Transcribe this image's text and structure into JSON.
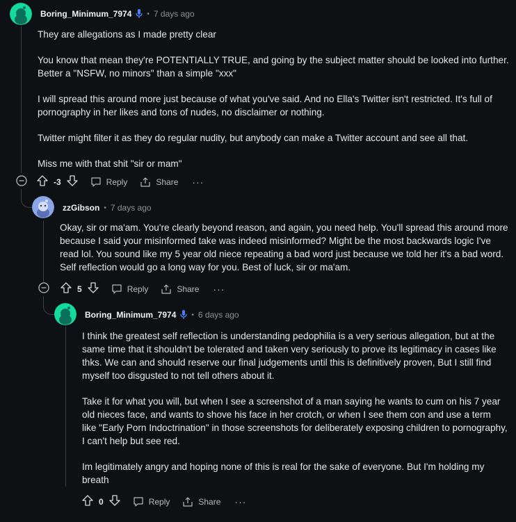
{
  "comments": [
    {
      "author": "Boring_Minimum_7974",
      "time": "7 days ago",
      "paragraphs": [
        "They are allegations as I made pretty clear",
        "You know that mean they're POTENTIALLY TRUE, and going by the subject matter should be looked into further. Better a \"NSFW, no minors\" than a simple \"xxx\"",
        "I will spread this around more just because of what you've said. And no Ella's Twitter isn't restricted. It's full of pornography in her likes and tons of nudes, no disclaimer or nothing.",
        "Twitter might filter it as they do regular nudity, but anybody can make a Twitter account and see all that.",
        "Miss me with that shit \"sir or mam\""
      ],
      "score": "-3",
      "reply_label": "Reply",
      "share_label": "Share",
      "more_label": "···",
      "avatar_color": "#14d9a0"
    },
    {
      "author": "zzGibson",
      "time": "7 days ago",
      "paragraphs": [
        "Okay, sir or ma'am. You're clearly beyond reason, and again, you need help. You'll spread this around more because I said your misinformed take was indeed misinformed? Might be the most backwards logic I've read lol. You sound like my 5 year old niece repeating a bad word just because we told her it's a bad word. Self reflection would go a long way for you. Best of luck, sir or ma'am."
      ],
      "score": "5",
      "reply_label": "Reply",
      "share_label": "Share",
      "more_label": "···",
      "avatar_color": "#8aa6e8"
    },
    {
      "author": "Boring_Minimum_7974",
      "time": "6 days ago",
      "paragraphs": [
        "I think the greatest self reflection is understanding pedophilia is a very serious allegation, but at the same time that it shouldn't be tolerated and taken very seriously to prove its legitimacy in cases like thks. We can and should reserve our final judgements until this is definitively proven, But I still find myself too disgusted to not tell others about it.",
        "Take it for what you will, but when I see a screenshot of a man saying he wants to cum on his 7 year old nieces face, and wants to shove his face in her crotch, or when I see them con and use a term like \"Early Porn Indoctrination\" in those screenshots for deliberately exposing children to pornography, I can't help but see red.",
        "Im legitimately angry and hoping none of this is real for the sake of everyone. But I'm holding my breath"
      ],
      "score": "0",
      "reply_label": "Reply",
      "share_label": "Share",
      "more_label": "···",
      "avatar_color": "#14d9a0"
    }
  ]
}
